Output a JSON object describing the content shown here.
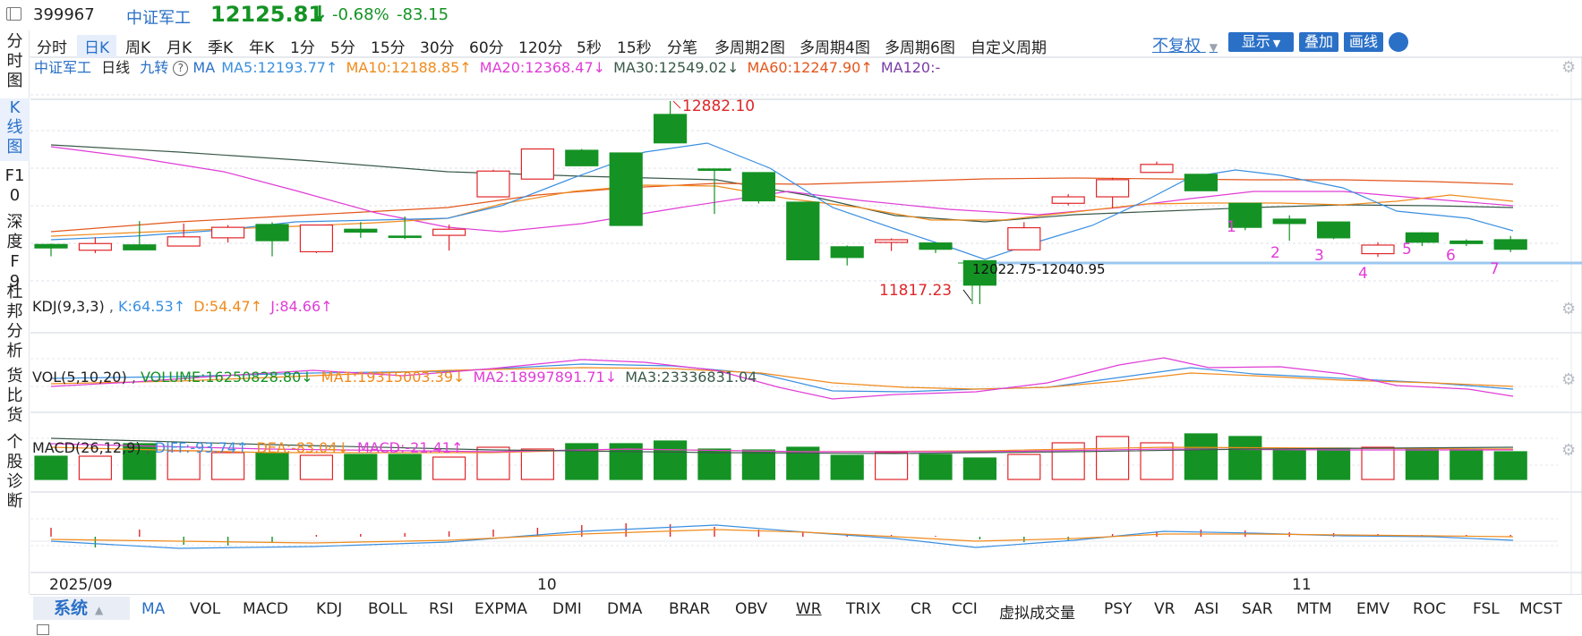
{
  "header": {
    "code": "399967",
    "name": "中证军工",
    "price": "12125.81",
    "price_arrow": "↓",
    "change_pct": "-0.68%",
    "change_abs": "-83.15"
  },
  "left_nav": [
    {
      "label": "分时图"
    },
    {
      "label": "K线图",
      "active": true
    },
    {
      "label": "F10"
    },
    {
      "label": "深度F9"
    },
    {
      "label": "杜邦分析"
    },
    {
      "label": "货比货"
    },
    {
      "label": "个股诊断"
    }
  ],
  "periods": [
    {
      "label": "分时"
    },
    {
      "label": "日K",
      "active": true
    },
    {
      "label": "周K"
    },
    {
      "label": "月K"
    },
    {
      "label": "季K"
    },
    {
      "label": "年K"
    },
    {
      "label": "1分"
    },
    {
      "label": "5分"
    },
    {
      "label": "15分"
    },
    {
      "label": "30分"
    },
    {
      "label": "60分"
    },
    {
      "label": "120分"
    },
    {
      "label": "5秒"
    },
    {
      "label": "15秒"
    },
    {
      "label": "分笔"
    },
    {
      "label": "多周期2图"
    },
    {
      "label": "多周期4图"
    },
    {
      "label": "多周期6图"
    },
    {
      "label": "自定义周期"
    }
  ],
  "toolbar": {
    "adjust": "不复权",
    "display": "显示",
    "overlay": "叠加",
    "draw": "画线"
  },
  "main_legend": {
    "name": "中证军工",
    "period": "日线",
    "jiuzhuan": "九转",
    "ma": "MA",
    "ma5": "MA5:12193.77↑",
    "ma10": "MA10:12188.85↑",
    "ma20": "MA20:12368.47↓",
    "ma30": "MA30:12549.02↓",
    "ma60": "MA60:12247.90↑",
    "ma120": "MA120:-"
  },
  "annotations": {
    "high": "12882.10",
    "low": "11817.23",
    "gap": "12022.75-12040.95",
    "nine_turn": [
      "1",
      "2",
      "3",
      "4",
      "5",
      "6",
      "7"
    ]
  },
  "kdj_legend": {
    "name": "KDJ(9,3,3)",
    "k": "K:64.53↑",
    "d": "D:54.47↑",
    "j": "J:84.66↑"
  },
  "vol_legend": {
    "name": "VOL(5,10,20)",
    "volume": "VOLUME:16250828.80↓",
    "ma1": "MA1:19315003.39↓",
    "ma2": "MA2:18997891.71↓",
    "ma3": "MA3:23336831.04"
  },
  "macd_legend": {
    "name": "MACD(26,12,9)",
    "diff": "DIFF:-93.74↑",
    "dea": "DEA:-83.04↓",
    "macd": "MACD:-21.41↑"
  },
  "x_axis_labels": [
    "2025/09",
    "10",
    "11"
  ],
  "indicator_tabs": {
    "system": "系统",
    "items": [
      "MA",
      "VOL",
      "MACD",
      "KDJ",
      "BOLL",
      "RSI",
      "EXPMA",
      "DMI",
      "DMA",
      "BRAR",
      "OBV",
      "WR",
      "TRIX",
      "CR",
      "CCI",
      "虚拟成交量",
      "PSY",
      "VR",
      "ASI",
      "SAR",
      "MTM",
      "EMV",
      "ROC",
      "FSL",
      "MCST"
    ]
  },
  "colors": {
    "up": "#e0262a",
    "down": "#149324",
    "ma5": "#3a8fe0",
    "ma10": "#f08a1c",
    "ma20": "#e03cd6",
    "ma30": "#3a5a4a",
    "ma60": "#e3561c",
    "accent": "#2a70c7"
  },
  "chart_data": {
    "type": "candlestick",
    "price_scale": {
      "high_label": 12882.1,
      "low_label": 11817.23
    },
    "candles": [
      {
        "o": 12130,
        "c": 12112,
        "h": 12135,
        "l": 12068
      },
      {
        "o": 12100,
        "c": 12135,
        "h": 12168,
        "l": 12085
      },
      {
        "o": 12128,
        "c": 12102,
        "h": 12253,
        "l": 12102
      },
      {
        "o": 12122,
        "c": 12170,
        "h": 12240,
        "l": 12122
      },
      {
        "o": 12165,
        "c": 12220,
        "h": 12232,
        "l": 12140
      },
      {
        "o": 12235,
        "c": 12150,
        "h": 12247,
        "l": 12068
      },
      {
        "o": 12092,
        "c": 12232,
        "h": 12232,
        "l": 12085
      },
      {
        "o": 12210,
        "c": 12195,
        "h": 12248,
        "l": 12165
      },
      {
        "o": 12174,
        "c": 12170,
        "h": 12277,
        "l": 12158
      },
      {
        "o": 12178,
        "c": 12210,
        "h": 12234,
        "l": 12098
      },
      {
        "o": 12380,
        "c": 12515,
        "h": 12522,
        "l": 12380
      },
      {
        "o": 12473,
        "c": 12631,
        "h": 12631,
        "l": 12473
      },
      {
        "o": 12624,
        "c": 12543,
        "h": 12631,
        "l": 12543
      },
      {
        "o": 12610,
        "c": 12230,
        "h": 12610,
        "l": 12230
      },
      {
        "o": 12812,
        "c": 12663,
        "h": 12882.1,
        "l": 12663
      },
      {
        "o": 12526,
        "c": 12522,
        "h": 12528,
        "l": 12290
      },
      {
        "o": 12507,
        "c": 12359,
        "h": 12507,
        "l": 12345
      },
      {
        "o": 12352,
        "c": 12050,
        "h": 12352,
        "l": 12050
      },
      {
        "o": 12118,
        "c": 12062,
        "h": 12125,
        "l": 12020
      },
      {
        "o": 12141,
        "c": 12155,
        "h": 12162,
        "l": 12096
      },
      {
        "o": 12138,
        "c": 12105,
        "h": 12138,
        "l": 12085
      },
      {
        "o": 12045,
        "c": 11917,
        "h": 12045,
        "l": 11817.23
      },
      {
        "o": 12102,
        "c": 12218,
        "h": 12247,
        "l": 12102
      },
      {
        "o": 12346,
        "c": 12380,
        "h": 12394,
        "l": 12335
      },
      {
        "o": 12380,
        "c": 12470,
        "h": 12480,
        "l": 12320
      },
      {
        "o": 12508,
        "c": 12550,
        "h": 12565,
        "l": 12523
      },
      {
        "o": 12498,
        "c": 12412,
        "h": 12498,
        "l": 12412
      },
      {
        "o": 12346,
        "c": 12220,
        "h": 12346,
        "l": 12205
      },
      {
        "o": 12263,
        "c": 12240,
        "h": 12283,
        "l": 12150
      },
      {
        "o": 12248,
        "c": 12165,
        "h": 12248,
        "l": 12158
      },
      {
        "o": 12082,
        "c": 12127,
        "h": 12142,
        "l": 12065
      },
      {
        "o": 12191,
        "c": 12142,
        "h": 12195,
        "l": 12122
      },
      {
        "o": 12148,
        "c": 12135,
        "h": 12157,
        "l": 12122
      },
      {
        "o": 12155,
        "c": 12105,
        "h": 12175,
        "l": 12090
      }
    ]
  }
}
